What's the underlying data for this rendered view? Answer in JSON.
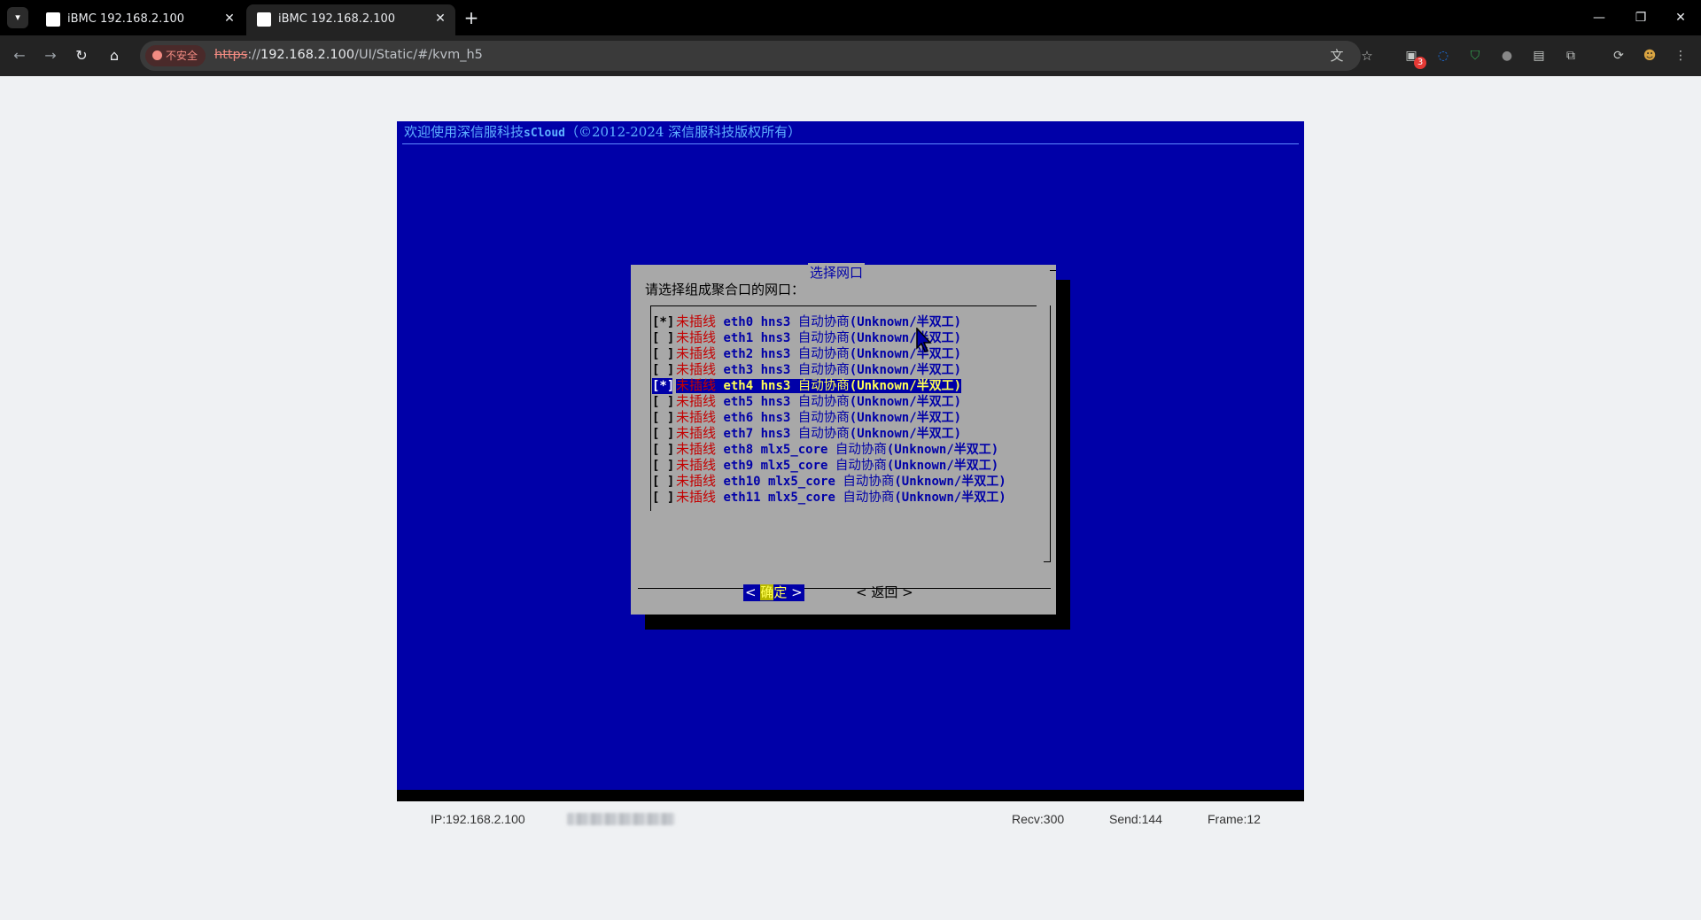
{
  "browser": {
    "tabs": [
      {
        "title": "iBMC 192.168.2.100",
        "active": false
      },
      {
        "title": "iBMC 192.168.2.100",
        "active": true
      }
    ],
    "security_label": "不安全",
    "url_scheme": "https",
    "url_sep": "://",
    "url_host": "192.168.2.100",
    "url_path": "/UI/Static/#/kvm_h5",
    "extension_badge": "3"
  },
  "kvm": {
    "banner_cn": "欢迎使用深信服科技",
    "banner_product": "sCloud",
    "banner_copy": "（©2012-2024 深信服科技版权所有）",
    "dialog": {
      "title": "选择网口",
      "prompt": "请选择组成聚合口的网口：",
      "rows": [
        {
          "check": "[*]",
          "status": "未插线",
          "iface": "eth0",
          "driver": "hns3",
          "mode": "自动协商",
          "link": "(Unknown/半双工)",
          "selected": false
        },
        {
          "check": "[ ]",
          "status": "未插线",
          "iface": "eth1",
          "driver": "hns3",
          "mode": "自动协商",
          "link": "(Unknown/半双工)",
          "selected": false
        },
        {
          "check": "[ ]",
          "status": "未插线",
          "iface": "eth2",
          "driver": "hns3",
          "mode": "自动协商",
          "link": "(Unknown/半双工)",
          "selected": false
        },
        {
          "check": "[ ]",
          "status": "未插线",
          "iface": "eth3",
          "driver": "hns3",
          "mode": "自动协商",
          "link": "(Unknown/半双工)",
          "selected": false
        },
        {
          "check": "[*]",
          "status": "未插线",
          "iface": "eth4",
          "driver": "hns3",
          "mode": "自动协商",
          "link": "(Unknown/半双工)",
          "selected": true
        },
        {
          "check": "[ ]",
          "status": "未插线",
          "iface": "eth5",
          "driver": "hns3",
          "mode": "自动协商",
          "link": "(Unknown/半双工)",
          "selected": false
        },
        {
          "check": "[ ]",
          "status": "未插线",
          "iface": "eth6",
          "driver": "hns3",
          "mode": "自动协商",
          "link": "(Unknown/半双工)",
          "selected": false
        },
        {
          "check": "[ ]",
          "status": "未插线",
          "iface": "eth7",
          "driver": "hns3",
          "mode": "自动协商",
          "link": "(Unknown/半双工)",
          "selected": false
        },
        {
          "check": "[ ]",
          "status": "未插线",
          "iface": "eth8",
          "driver": "mlx5_core",
          "mode": "自动协商",
          "link": "(Unknown/半双工)",
          "selected": false
        },
        {
          "check": "[ ]",
          "status": "未插线",
          "iface": "eth9",
          "driver": "mlx5_core",
          "mode": "自动协商",
          "link": "(Unknown/半双工)",
          "selected": false
        },
        {
          "check": "[ ]",
          "status": "未插线",
          "iface": "eth10",
          "driver": "mlx5_core",
          "mode": "自动协商",
          "link": "(Unknown/半双工)",
          "selected": false
        },
        {
          "check": "[ ]",
          "status": "未插线",
          "iface": "eth11",
          "driver": "mlx5_core",
          "mode": "自动协商",
          "link": "(Unknown/半双工)",
          "selected": false
        }
      ],
      "ok_open": "<",
      "ok_hot": "确",
      "ok_rest": "定",
      "ok_close": ">",
      "back_label": "< 返回 >"
    }
  },
  "status_bar": {
    "ip": "IP:192.168.2.100",
    "recv": "Recv:300",
    "send": "Send:144",
    "frame": "Frame:12"
  }
}
